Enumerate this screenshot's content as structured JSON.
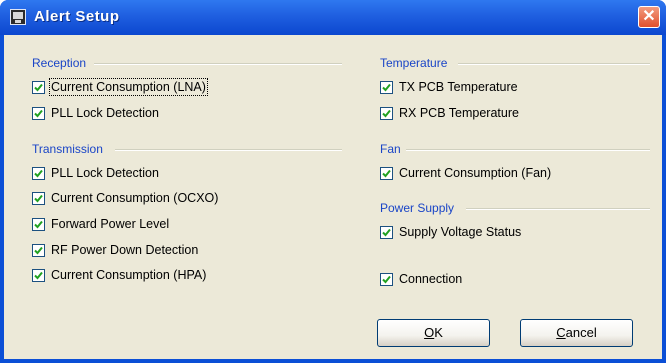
{
  "window": {
    "title": "Alert Setup",
    "close_symbol": "✕"
  },
  "reception": {
    "label": "Reception",
    "items": [
      {
        "label": "Current Consumption (LNA)",
        "checked": true
      },
      {
        "label": "PLL Lock Detection",
        "checked": true
      }
    ]
  },
  "transmission": {
    "label": "Transmission",
    "items": [
      {
        "label": "PLL Lock Detection",
        "checked": true
      },
      {
        "label": "Current Consumption (OCXO)",
        "checked": true
      },
      {
        "label": "Forward Power Level",
        "checked": true
      },
      {
        "label": "RF Power Down Detection",
        "checked": true
      },
      {
        "label": "Current Consumption (HPA)",
        "checked": true
      }
    ]
  },
  "temperature": {
    "label": "Temperature",
    "items": [
      {
        "label": "TX PCB Temperature",
        "checked": true
      },
      {
        "label": "RX PCB Temperature",
        "checked": true
      }
    ]
  },
  "fan": {
    "label": "Fan",
    "items": [
      {
        "label": "Current Consumption (Fan)",
        "checked": true
      }
    ]
  },
  "power_supply": {
    "label": "Power Supply",
    "items": [
      {
        "label": "Supply Voltage Status",
        "checked": true
      }
    ]
  },
  "connection": {
    "label": "Connection",
    "checked": true
  },
  "buttons": {
    "ok": {
      "mnemonic": "O",
      "rest": "K"
    },
    "cancel": {
      "mnemonic": "C",
      "rest": "ancel"
    }
  },
  "colors": {
    "title_bar": "#0c47cf",
    "group_label": "#1a45c7",
    "check_mark": "#21a121",
    "dialog_face": "#ece9d8"
  },
  "icons": [
    "monitor-icon",
    "close-icon",
    "checkmark-icon"
  ]
}
